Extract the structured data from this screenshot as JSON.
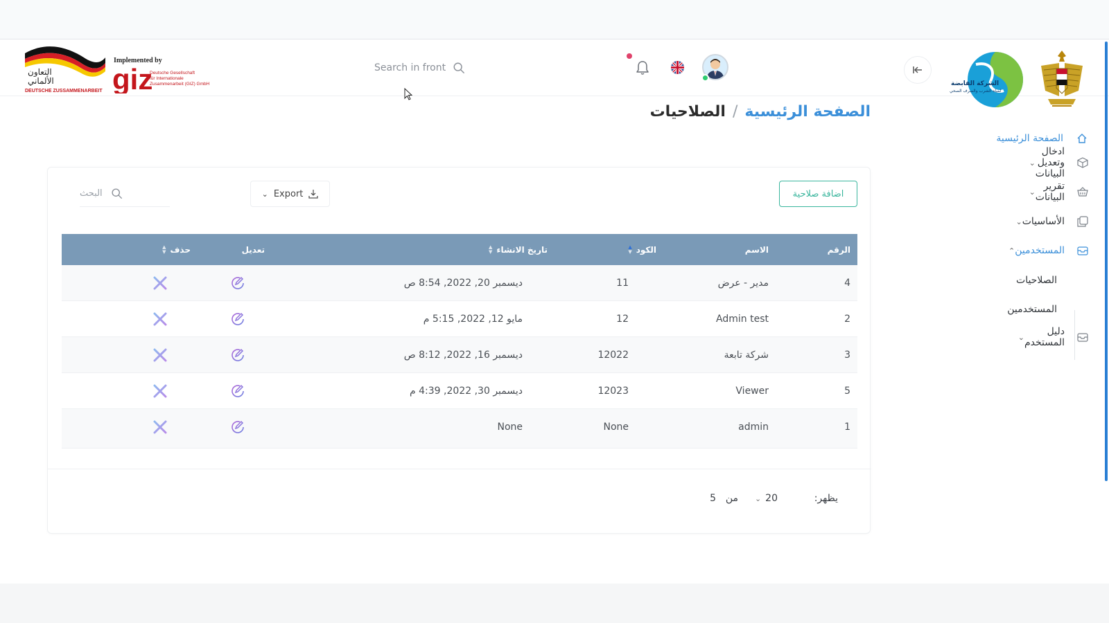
{
  "header": {
    "search_placeholder": "Search in front",
    "partner_logo": {
      "implemented_by": "Implemented by",
      "giz": "giz",
      "giz_line1": "Deutsche Gesellschaft",
      "giz_line2": "für Internationale",
      "giz_line3": "Zusammenarbeit (GIZ) GmbH",
      "coop_ar_1": "التعاون",
      "coop_ar_2": "الألماني",
      "coop_de": "DEUTSCHE ZUSSAMMENARBEIT"
    },
    "water_logo_text_1": "الشركة القابضة",
    "water_logo_text_2": "لمياه الشرب والصرف الصحي",
    "collapse_icon": "collapse-arrow-icon",
    "notification_icon": "bell-icon",
    "language_icon": "uk-flag-icon",
    "avatar_icon": "user-avatar-icon"
  },
  "breadcrumb": {
    "home": "الصفحة الرئيسية",
    "separator": "/",
    "current": "الصلاحيات"
  },
  "sidebar": {
    "items": [
      {
        "label": "الصفحة الرئيسية",
        "icon": "home-icon"
      },
      {
        "label": "ادخال وتعديل البيانات",
        "icon": "cube-icon"
      },
      {
        "label": "تقرير البيانات",
        "icon": "basket-icon"
      },
      {
        "label": "الأساسيات",
        "icon": "copy-icon"
      },
      {
        "label": "المستخدمين",
        "icon": "inbox-icon"
      },
      {
        "label": "دليل المستخدم",
        "icon": "inbox-icon"
      }
    ],
    "subitems": [
      {
        "label": "الصلاحيات"
      },
      {
        "label": "المستخدمين"
      }
    ]
  },
  "toolbar": {
    "add_label": "اضافة صلاحية",
    "export_label": "Export",
    "search_placeholder": "البحث"
  },
  "table": {
    "columns": {
      "id": "الرقم",
      "name": "الاسم",
      "code": "الكود",
      "created": "تاريخ الانشاء",
      "edit": "تعديل",
      "delete": "حذف"
    },
    "rows": [
      {
        "id": "4",
        "name": "مدير - عرض",
        "code": "11",
        "created": "ديسمبر 20, 2022, 8:54 ص"
      },
      {
        "id": "2",
        "name": "Admin test",
        "code": "12",
        "created": "مايو 12, 2022, 5:15 م"
      },
      {
        "id": "3",
        "name": "شركة تابعة",
        "code": "12022",
        "created": "ديسمبر 16, 2022, 8:12 ص"
      },
      {
        "id": "5",
        "name": "Viewer",
        "code": "12023",
        "created": "ديسمبر 30, 2022, 4:39 م"
      },
      {
        "id": "1",
        "name": "admin",
        "code": "None",
        "created": "None"
      }
    ]
  },
  "pagination": {
    "show_label": "يظهر:",
    "page_size": "20",
    "of_label": "من",
    "total": "5"
  },
  "colors": {
    "primary": "#3b8fd9",
    "accent": "#38b59c",
    "table_header": "#7a9ab7",
    "delete": "#8e88e6",
    "edit": "#9b6bd6"
  }
}
